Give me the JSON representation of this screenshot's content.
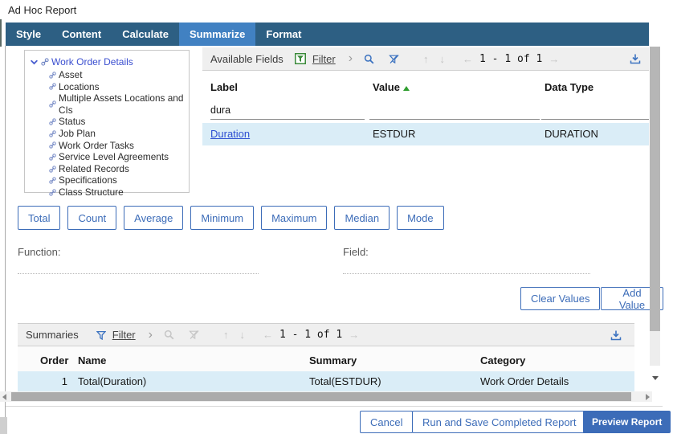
{
  "colors": {
    "tabbar-bg": "#2d5f83",
    "tab-active-bg": "#4181c2",
    "accent": "#3c6cb8",
    "link": "#3b4fd0",
    "row-highlight": "#daedf7",
    "toolbar-bg": "#efefef"
  },
  "window": {
    "title": "Ad Hoc Report"
  },
  "tabs": {
    "items": [
      {
        "label": "Style"
      },
      {
        "label": "Content"
      },
      {
        "label": "Calculate"
      },
      {
        "label": "Summarize"
      },
      {
        "label": "Format"
      }
    ],
    "active": "Summarize"
  },
  "tree": {
    "root": "Work Order Details",
    "children": [
      "Asset",
      "Locations",
      "Multiple Assets Locations and CIs",
      "Status",
      "Job Plan",
      "Work Order Tasks",
      "Service Level Agreements",
      "Related Records",
      "Specifications",
      "Class Structure"
    ]
  },
  "icons": {
    "chevron_expand": "›",
    "up_arrow": "↑",
    "down_arrow": "↓",
    "prev_arrow": "←",
    "next_arrow": "→"
  },
  "available_fields": {
    "title": "Available Fields",
    "filter_label": "Filter",
    "pager": "1 - 1 of 1",
    "columns": {
      "label": "Label",
      "value": "Value",
      "data_type": "Data Type"
    },
    "sort": {
      "column": "Value",
      "direction": "asc"
    },
    "filter": {
      "label": "dura",
      "value": "",
      "data_type": ""
    },
    "rows": [
      {
        "label": "Duration",
        "value": "ESTDUR",
        "data_type": "DURATION"
      }
    ]
  },
  "aggregates": {
    "buttons": [
      "Total",
      "Count",
      "Average",
      "Minimum",
      "Maximum",
      "Median",
      "Mode"
    ]
  },
  "function_field": {
    "function_label": "Function:",
    "field_label": "Field:",
    "function_value": "",
    "field_value": ""
  },
  "value_actions": {
    "clear_label": "Clear Values",
    "add_label": "Add Value"
  },
  "summaries": {
    "title": "Summaries",
    "filter_label": "Filter",
    "pager": "1 - 1 of 1",
    "columns": {
      "order": "Order",
      "name": "Name",
      "summary": "Summary",
      "category": "Category"
    },
    "rows": [
      {
        "order": "1",
        "name": "Total(Duration)",
        "summary": "Total(ESTDUR)",
        "category": "Work Order Details"
      }
    ]
  },
  "footer": {
    "cancel_label": "Cancel",
    "run_save_label": "Run and Save Completed Report",
    "preview_label": "Preview Report"
  }
}
